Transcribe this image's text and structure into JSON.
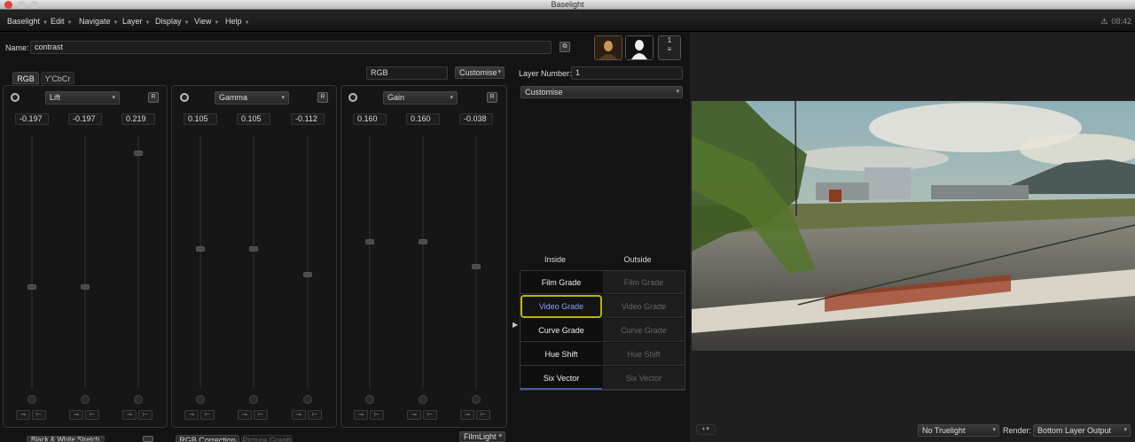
{
  "window": {
    "title": "Baselight",
    "time": "08:42"
  },
  "menus": [
    {
      "label": "Baselight"
    },
    {
      "label": "Edit"
    },
    {
      "label": "Navigate"
    },
    {
      "label": "Layer"
    },
    {
      "label": "Display"
    },
    {
      "label": "View"
    },
    {
      "label": "Help"
    }
  ],
  "name_field": {
    "label": "Name:",
    "value": "contrast"
  },
  "layer_stack": {
    "count": "1"
  },
  "color_tabs": [
    "RGB",
    "Y'CbCr"
  ],
  "mode": {
    "space": "RGB",
    "customise": "Customise"
  },
  "layer_number": {
    "label": "Layer Number:",
    "value": "1"
  },
  "right_customise": "Customise",
  "panels": [
    {
      "name": "Lift",
      "values": [
        "-0.197",
        "-0.197",
        "0.219"
      ],
      "levels": [
        0.41,
        0.41,
        0.94
      ]
    },
    {
      "name": "Gamma",
      "values": [
        "0.105",
        "0.105",
        "-0.112"
      ],
      "levels": [
        0.56,
        0.56,
        0.46
      ]
    },
    {
      "name": "Gain",
      "values": [
        "0.160",
        "0.160",
        "-0.038"
      ],
      "levels": [
        0.59,
        0.59,
        0.49
      ]
    }
  ],
  "grade_headers": {
    "inside": "Inside",
    "outside": "Outside"
  },
  "grades": [
    {
      "inside": "Film Grade",
      "outside": "Film Grade"
    },
    {
      "inside": "Video Grade",
      "outside": "Video Grade"
    },
    {
      "inside": "Curve Grade",
      "outside": "Curve Grade"
    },
    {
      "inside": "Hue Shift",
      "outside": "Hue Shift"
    },
    {
      "inside": "Six Vector",
      "outside": "Six Vector"
    }
  ],
  "active_grade": "Video Grade",
  "bottom": {
    "left_select": "Black & White Stretch",
    "tab_active": "RGB Correction",
    "tab_inactive": "Picture Graph",
    "filmlight": "FilmLight"
  },
  "viewer": {
    "truelight": "No Truelight",
    "render_label": "Render:",
    "render_value": "Bottom Layer Output"
  },
  "colors": {
    "accent": "#8fa0ff",
    "highlight": "#c8c800"
  }
}
